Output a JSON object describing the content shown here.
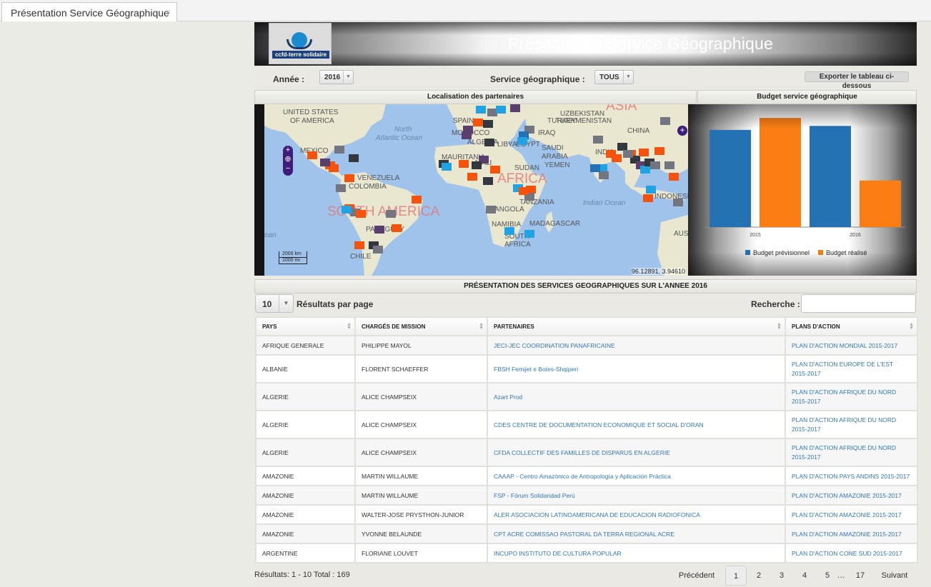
{
  "tab": {
    "title": "Présentation Service Géographique",
    "close": "×"
  },
  "header": {
    "title": "Présentation Service Géographique",
    "logo_text": "ccfd-terre solidaire"
  },
  "filters": {
    "year_label": "Année :",
    "year_value": "2016",
    "service_label": "Service géographique :",
    "service_value": "TOUS",
    "export_label": "Exporter le tableau ci-dessous"
  },
  "map": {
    "title": "Localisation des partenaires",
    "coords": "96.12891, 3.94610",
    "scale_km": "2000 km",
    "scale_mi": "1000 mi",
    "labels": {
      "usa": "UNITED STATES",
      "usa2": "OF AMERICA",
      "mexico": "MEXICO",
      "venezuela": "VENEZUELA",
      "colombia": "COLOMBIA",
      "paraguay": "PARAGUAY",
      "chile": "CHILE",
      "south_america": "SOUTH AMERICA",
      "north_atlantic": "North",
      "north_atlantic2": "Atlantic Ocean",
      "ocean_left": "ean",
      "spain": "SPAIN",
      "morocco": "MOROCCO",
      "algeria": "ALGERIA",
      "libya": "LIBYA",
      "egypt": "EGYPT",
      "mauritania": "MAURITANIA",
      "mali": "MALI",
      "sudan": "SUDAN",
      "africa": "AFRICA",
      "angola": "ANGOLA",
      "tanzania": "TANZANIA",
      "namibia": "NAMIBIA",
      "madagascar": "MADAGASCAR",
      "south_africa": "SOUTH",
      "south_africa2": "AFRICA",
      "iraq": "IRAQ",
      "turkey": "TURKEY",
      "uzbekistan": "UZBEKISTAN",
      "turkmenistan": "TURKMENISTAN",
      "china": "CHINA",
      "india": "INDIA",
      "saudi": "SAUDI",
      "arabia": "ARABIA",
      "yemen": "YEMEN",
      "indian_ocean": "Indian Ocean",
      "indonesia": "INDONESIA",
      "aus": "AUS",
      "asia": "ASIA"
    }
  },
  "chart_data": {
    "type": "bar",
    "title": "Budget service géographique",
    "categories": [
      "2015",
      "2016"
    ],
    "series": [
      {
        "name": "Budget prévisionnel",
        "color": "#2472b3",
        "values": [
          7300000,
          7600000
        ]
      },
      {
        "name": "Budget réalisé",
        "color": "#fa7d13",
        "values": [
          8200000,
          3500000
        ]
      }
    ],
    "ylim": [
      0,
      8800000
    ],
    "legend": "bottom"
  },
  "table": {
    "title": "PRÉSENTATION DES SERVICES GEOGRAPHIQUES SUR L'ANNEE 2016",
    "perpage_value": "10",
    "perpage_label": "Résultats par page",
    "search_label": "Recherche :",
    "columns": [
      "PAYS",
      "CHARGÉS DE MISSION",
      "PARTENAIRES",
      "PLANS D'ACTION"
    ],
    "rows": [
      {
        "pays": "AFRIQUE GENERALE",
        "charge": "PHILIPPE MAYOL",
        "partenaire": "JECI-JEC COORDINATION PANAFRICAINE",
        "plan1": "PLAN D'ACTION MONDIAL 2015-2017",
        "plan2": ""
      },
      {
        "pays": "ALBANIE",
        "charge": "FLORENT SCHAEFFER",
        "partenaire": "FBSH Femijet e Botes-Shqiperi",
        "plan1": "PLAN D'ACTION EUROPE DE L'EST",
        "plan2": "2015-2017"
      },
      {
        "pays": "ALGERIE",
        "charge": "ALICE CHAMPSEIX",
        "partenaire": "Azart Prod",
        "plan1": "PLAN D'ACTION AFRIQUE DU NORD",
        "plan2": "2015-2017"
      },
      {
        "pays": "ALGERIE",
        "charge": "ALICE CHAMPSEIX",
        "partenaire": "CDES CENTRE DE DOCUMENTATION ECONOMIQUE ET SOCIAL D'ORAN",
        "plan1": "PLAN D'ACTION AFRIQUE DU NORD",
        "plan2": "2015-2017"
      },
      {
        "pays": "ALGERIE",
        "charge": "ALICE CHAMPSEIX",
        "partenaire": "CFDA COLLECTIF DES FAMILLES DE DISPARUS EN ALGERIE",
        "plan1": "PLAN D'ACTION AFRIQUE DU NORD",
        "plan2": "2015-2017"
      },
      {
        "pays": "AMAZONIE",
        "charge": "MARTIN WILLAUME",
        "partenaire": "CAAAP - Centro Amazónico de Antropología y Aplicación Práctica",
        "plan1": "PLAN D'ACTION PAYS ANDINS 2015-2017",
        "plan2": ""
      },
      {
        "pays": "AMAZONIE",
        "charge": "MARTIN WILLAUME",
        "partenaire": "FSP - Fórum Solidaridad Perú",
        "plan1": "PLAN D'ACTION AMAZONIE 2015-2017",
        "plan2": ""
      },
      {
        "pays": "AMAZONIE",
        "charge": "WALTER-JOSE PRYSTHON-JUNIOR",
        "partenaire": "ALER ASOCIACION LATINOAMERICANA DE EDUCACION RADIOFONICA",
        "plan1": "PLAN D'ACTION AMAZONIE 2015-2017",
        "plan2": ""
      },
      {
        "pays": "AMAZONIE",
        "charge": "YVONNE BELAUNDE",
        "partenaire": "CPT ACRE COMISSAO PASTORAL DA TERRA REGIONAL ACRE",
        "plan1": "PLAN D'ACTION AMAZONIE 2015-2017",
        "plan2": ""
      },
      {
        "pays": "ARGENTINE",
        "charge": "FLORIANE LOUVET",
        "partenaire": "INCUPO INSTITUTO DE CULTURA POPULAR",
        "plan1": "PLAN D'ACTION CONE SUD 2015-2017",
        "plan2": ""
      }
    ]
  },
  "footer": {
    "info": "Résultats: 1 - 10 Total : 169",
    "prev": "Précédent",
    "pages": [
      "1",
      "2",
      "3",
      "4",
      "5"
    ],
    "ellipsis": "…",
    "last": "17",
    "next": "Suivant"
  }
}
